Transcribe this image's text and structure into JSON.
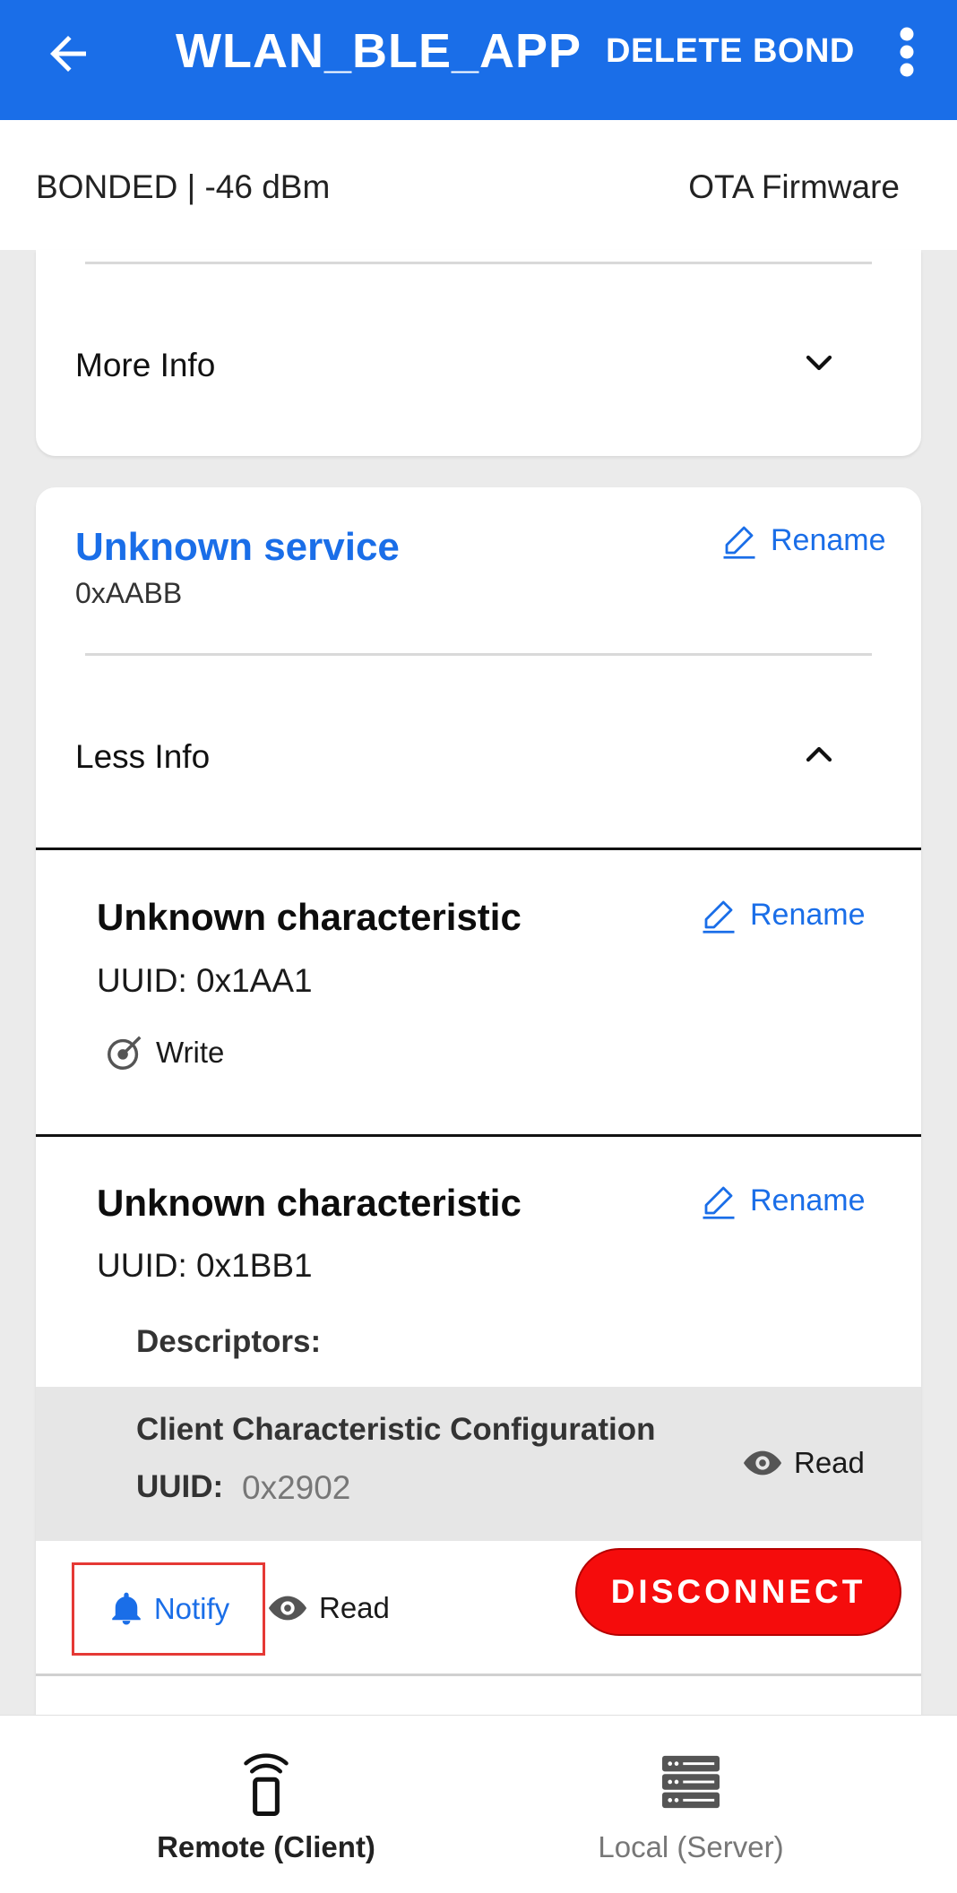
{
  "appbar": {
    "back_icon": "arrow-left-icon",
    "title": "WLAN_BLE_APP",
    "delete_bond": "DELETE BOND",
    "more_icon": "more-vert-icon"
  },
  "status": {
    "state": "BONDED | -46 dBm",
    "ota": "OTA Firmware"
  },
  "prev_service": {
    "info_toggle": "More Info"
  },
  "service": {
    "name": "Unknown service",
    "uuid": "0xAABB",
    "rename": "Rename",
    "info_toggle": "Less Info"
  },
  "characteristics": [
    {
      "name": "Unknown characteristic",
      "uuid": "UUID:  0x1AA1",
      "rename": "Rename",
      "properties": [
        "Write"
      ]
    },
    {
      "name": "Unknown characteristic",
      "uuid": "UUID:  0x1BB1",
      "rename": "Rename",
      "descriptors_label": "Descriptors:",
      "descriptor": {
        "name": "Client Characteristic Configuration",
        "uuid_label": "UUID:",
        "uuid": "0x2902",
        "property": "Read"
      },
      "properties": [
        "Notify",
        "Read"
      ]
    }
  ],
  "disconnect": "DISCONNECT",
  "nav": {
    "items": [
      {
        "label": "Remote (Client)",
        "icon": "remote-device-icon",
        "active": true
      },
      {
        "label": "Local (Server)",
        "icon": "server-icon",
        "active": false
      }
    ]
  },
  "colors": {
    "accent": "#1a6ee8",
    "disconnect": "#f50c0c",
    "highlight_border": "#e53935"
  }
}
